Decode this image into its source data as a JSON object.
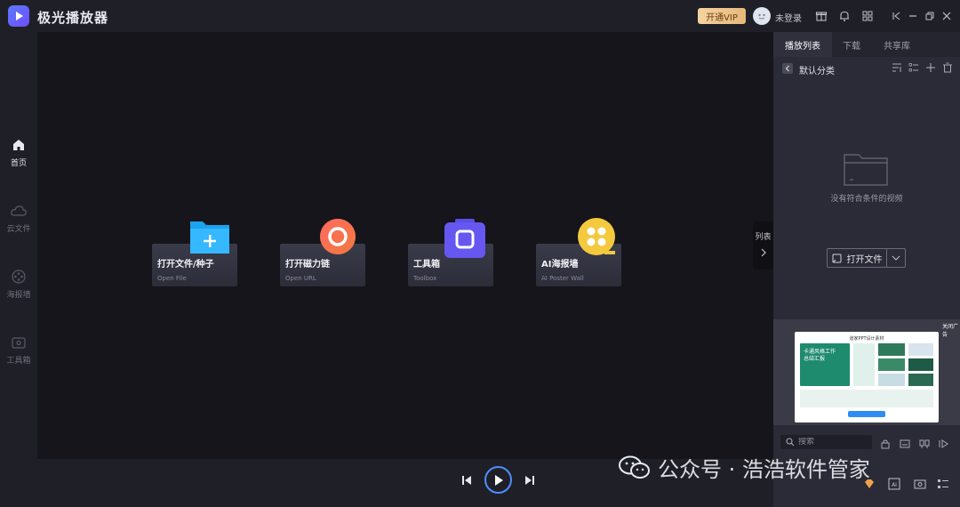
{
  "app": {
    "title": "极光播放器"
  },
  "titlebar": {
    "vip_label": "开通VIP",
    "login_label": "未登录"
  },
  "nav": {
    "items": [
      {
        "label": "首页",
        "icon": "home-icon",
        "active": true
      },
      {
        "label": "云文件",
        "icon": "cloud-icon",
        "active": false
      },
      {
        "label": "海报墙",
        "icon": "film-reel-icon",
        "active": false
      },
      {
        "label": "工具箱",
        "icon": "toolbox-icon",
        "active": false
      }
    ]
  },
  "cards": [
    {
      "title": "打开文件/种子",
      "subtitle": "Open File",
      "icon": "folder-plus-icon"
    },
    {
      "title": "打开磁力链",
      "subtitle": "Open URL",
      "icon": "magnet-ring-icon"
    },
    {
      "title": "工具箱",
      "subtitle": "Toolbox",
      "icon": "toolbox-bag-icon"
    },
    {
      "title": "AI海报墙",
      "subtitle": "AI Poster Wall",
      "icon": "film-reel-icon"
    }
  ],
  "list_toggle": {
    "label": "列表"
  },
  "right_panel": {
    "tabs": [
      {
        "label": "播放列表",
        "active": true
      },
      {
        "label": "下载",
        "active": false
      },
      {
        "label": "共享库",
        "active": false
      }
    ],
    "category_label": "默认分类",
    "empty_text": "没有符合条件的视频",
    "open_file_label": "打开文件",
    "ad": {
      "title": "道家PPT设计素材",
      "headline_1": "卡通风格工作",
      "headline_2": "总结汇报",
      "close_label": "关闭广告"
    },
    "search_placeholder": "搜索"
  },
  "watermark": {
    "text": "公众号 · 浩浩软件管家"
  },
  "colors": {
    "accent": "#4f8cff",
    "vip": "#e6b97a",
    "background": "#15151b"
  }
}
